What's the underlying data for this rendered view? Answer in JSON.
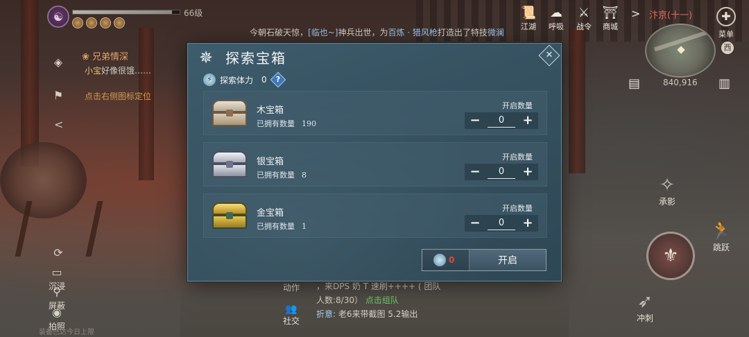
{
  "hud": {
    "level": "66级",
    "hp_fraction": 0.93,
    "quest": {
      "title": "兄弟情深",
      "desc_name": "小宝",
      "desc_rest": "好像很饿……",
      "hint": "点击右侧图标定位"
    },
    "left_buttons": [
      {
        "label": "沉浸",
        "icon": "immerse-icon"
      },
      {
        "label": "屏蔽",
        "icon": "hide-icon"
      },
      {
        "label": "拍照",
        "icon": "camera-icon"
      }
    ],
    "footer_note": "装备已达今日上限"
  },
  "broadcast": {
    "part1": "今朝石破天惊，",
    "link1": "[临也~]",
    "part2": "神兵出世，为",
    "link2": "百炼 · 猎风枪",
    "part3": "打造出了特技",
    "tail": "微澜"
  },
  "top_menu": [
    {
      "label": "江湖",
      "icon": "jianghu-icon"
    },
    {
      "label": "呼吸",
      "icon": "breath-icon"
    },
    {
      "label": "战令",
      "icon": "battle-pass-icon"
    },
    {
      "label": "商城",
      "icon": "shop-icon"
    }
  ],
  "top_right": {
    "city": "汴京(十一)",
    "menu_label": "菜单",
    "compass": "西",
    "coords": "840,916"
  },
  "right_actions": [
    {
      "label": "承影",
      "icon": "chengying-icon"
    },
    {
      "label": "跳跃",
      "icon": "jump-icon"
    },
    {
      "label": "冲刺",
      "icon": "dash-icon"
    }
  ],
  "chat": {
    "side_buttons": [
      {
        "label": "动作"
      },
      {
        "label": "社交"
      }
    ],
    "line1": "，来DPS 奶 T 速刷++++ ( 团队",
    "line2_prefix": "人数:8/30）",
    "line2_link": "点击组队",
    "line3_label": "折意:",
    "line3_text": " 老6来带截图 5.2输出"
  },
  "dialog": {
    "title": "探索宝箱",
    "stamina_label": "探索体力",
    "stamina_value": "0",
    "help": "?",
    "close": "✕",
    "qty_label": "开启数量",
    "owned_label": "已拥有数量",
    "rows": [
      {
        "name": "木宝箱",
        "owned": "190",
        "qty": "0",
        "chest": "wood"
      },
      {
        "name": "银宝箱",
        "owned": "8",
        "qty": "0",
        "chest": "silver"
      },
      {
        "name": "金宝箱",
        "owned": "1",
        "qty": "0",
        "chest": "gold"
      }
    ],
    "open_cost": "0",
    "open_label": "开启"
  }
}
